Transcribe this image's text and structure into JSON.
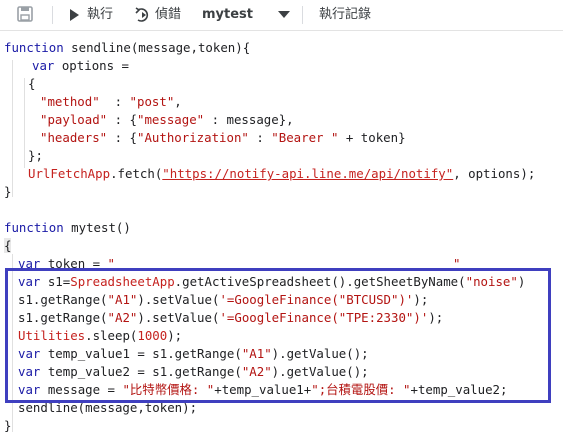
{
  "toolbar": {
    "run_label": "執行",
    "debug_label": "偵錯",
    "function_name": "mytest",
    "log_label": "執行記錄"
  },
  "code": {
    "l1": [
      "function",
      " sendline(message,token){"
    ],
    "l2": [
      "var",
      " options ="
    ],
    "l3": "{",
    "l4": [
      "\"method\"",
      "  : ",
      "\"post\"",
      ","
    ],
    "l5": [
      "\"payload\"",
      " : {",
      "\"message\"",
      " : message},"
    ],
    "l6": [
      "\"headers\"",
      " : {",
      "\"Authorization\"",
      " : ",
      "\"Bearer \"",
      " + token}"
    ],
    "l7": "};",
    "l8": [
      "UrlFetchApp",
      ".fetch(",
      "\"https://notify-api.line.me/api/notify\"",
      ", options);"
    ],
    "l9": "}",
    "l10": [
      "function",
      " mytest()"
    ],
    "l11": "{",
    "l12": [
      "var",
      " token = ",
      "\"",
      "\""
    ],
    "l13": [
      "var",
      " s1=",
      "SpreadsheetApp",
      ".getActiveSpreadsheet().getSheetByName(",
      "\"noise\"",
      ")"
    ],
    "l14": [
      "s1.getRange(",
      "\"A1\"",
      ").setValue(",
      "'=GoogleFinance(\"BTCUSD\")'",
      ");"
    ],
    "l15": [
      "s1.getRange(",
      "\"A2\"",
      ").setValue(",
      "'=GoogleFinance(\"TPE:2330\")'",
      ");"
    ],
    "l16": [
      "Utilities",
      ".sleep(",
      "1000",
      ");"
    ],
    "l17": [
      "var",
      " temp_value1 = s1.getRange(",
      "\"A1\"",
      ").getValue();"
    ],
    "l18": [
      "var",
      " temp_value2 = s1.getRange(",
      "\"A2\"",
      ").getValue();"
    ],
    "l19": [
      "var",
      " message = ",
      "\"比特幣價格: \"",
      "+temp_value1+",
      "\";台積電股價: \"",
      "+temp_value2;"
    ],
    "l20": "sendline(message,token);",
    "l21": "}"
  }
}
